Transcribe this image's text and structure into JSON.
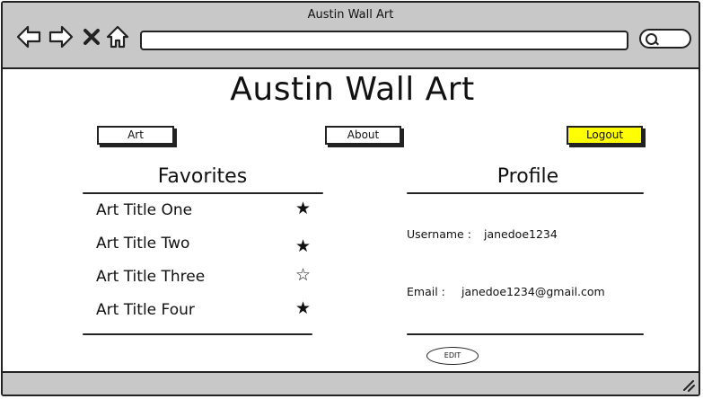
{
  "window": {
    "title": "Austin Wall Art"
  },
  "browser": {
    "icons": [
      "back-arrow-icon",
      "forward-arrow-icon",
      "close-icon",
      "home-icon",
      "search-icon",
      "resize-grip-icon"
    ],
    "url_value": "",
    "search_value": ""
  },
  "page": {
    "title": "Austin Wall Art"
  },
  "nav": {
    "art_label": "Art",
    "about_label": "About",
    "logout_label": "Logout",
    "logout_color": "#ffff00"
  },
  "favorites": {
    "heading": "Favorites",
    "items": [
      {
        "title": "Art Title One",
        "star": "★",
        "favorited": true
      },
      {
        "title": "Art Title Two",
        "star": "★",
        "favorited": true
      },
      {
        "title": "Art Title Three",
        "star": "☆",
        "favorited": false
      },
      {
        "title": "Art Title Four",
        "star": "★",
        "favorited": true
      }
    ]
  },
  "profile": {
    "heading": "Profile",
    "username_label": "Username :",
    "username_value": "janedoe1234",
    "email_label": "Email :",
    "email_value": "janedoe1234@gmail.com",
    "edit_label": "EDIT"
  },
  "colors": {
    "chrome_gray": "#c8c8c8",
    "accent_yellow": "#ffff00"
  }
}
